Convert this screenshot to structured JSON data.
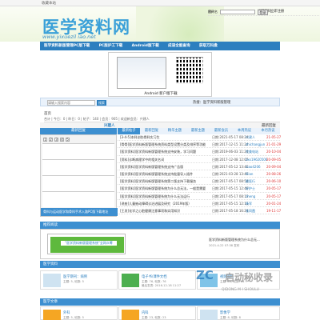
{
  "fav": {
    "label": "收藏本站"
  },
  "header": {
    "logo_cn": "医学资料网",
    "logo_url": "www.yixuezil iao.net"
  },
  "login": {
    "user_label": "用户名",
    "pass_label": "密码",
    "login_btn": "登录",
    "register": "注册",
    "forgot": "找回密码",
    "auto": "立即注册"
  },
  "nav": {
    "items": [
      "医学资料新版管理PC版下载",
      "PC版护工下载",
      "Android版下载",
      "成语全能查询",
      "获取万科盘"
    ]
  },
  "banner": {
    "caption": "Android 新户版下载"
  },
  "search": {
    "placeholder": "请输入搜索内容",
    "button": "搜索",
    "hot": "热搜：医学资料新版管理"
  },
  "crumb": "首页",
  "stats": "合计 | 今日：0 | 昨日：0 | 帖子：140 | 会员：905 | 欢迎新会员：兴建人",
  "toptitle": {
    "left": "兴建人",
    "right": "最新回复"
  },
  "left": {
    "head": "最新回复",
    "pages": [
      "1",
      "2",
      "3",
      "4",
      "5"
    ],
    "caption": "骨科与运动医学和骨科手术入路PC版下载地址"
  },
  "tabs": [
    "最新帖子",
    "最新回复",
    "精华主题",
    "最新主题",
    "最新会员",
    "本周热议",
    "本月热议"
  ],
  "rows": [
    {
      "t": "[3-4-5]本科创伤骨科实习生",
      "d": "日期:2021-05-17 08:24",
      "u": "兴建人",
      "x": "21-05-27"
    },
    {
      "t": "[骨骨]医学资料新版管理系统资料类型设置分类及排序等功能",
      "d": "日期:2017-12-15 11:24",
      "u": "zhichangjun",
      "x": "21-01-29"
    },
    {
      "t": "[医学资料]医学资料新版管理系统支持安装，学习问题",
      "d": "日期:2019-06-03 11:24",
      "u": "完美电站",
      "x": "20-10-04"
    },
    {
      "t": "[资料]诊断病理学中的相关名词",
      "d": "日期:2017-12-08 12:07",
      "u": "bxs19620506",
      "x": "20-09-05"
    },
    {
      "t": "[医学资料]医学资料新版管理系统支持广告版",
      "d": "日期:2017-05-12 13:45",
      "u": "xiao4206",
      "x": "20-09-04"
    },
    {
      "t": "[医学资料]医学资料新版管理系统支持批量导入插件",
      "d": "日期:2021-03-28 13:45",
      "u": "lilian",
      "x": "20-08-26"
    },
    {
      "t": "[医学资料]医学资料新版管理系统第二版支持下载服务",
      "d": "日期:2017-05-17 08:54",
      "u": "跟医行",
      "x": "20-06-10"
    },
    {
      "t": "[医学资料]医学资料新版管理系统为什么总无法，一般是需要",
      "d": "日期:2017-05-15 12:49",
      "u": "好护士",
      "x": "20-05-17"
    },
    {
      "t": "[医学资料]医学资料新版管理系统为什么无法运行",
      "d": "日期:2017-05-17 08:13",
      "u": "zheng",
      "x": "20-05-17"
    },
    {
      "t": "[讲座]儿童抽动障碍诊治进展及研究（2019年版）",
      "d": "日期:2017-05-15 12:11",
      "u": "杨军",
      "x": "20-01-24"
    },
    {
      "t": "[王发]化学之心脏健康注意事项和实用知识",
      "d": "日期:2017-05-18 16:24",
      "u": "张同霞",
      "x": "19-11-17"
    }
  ],
  "recommend": {
    "head": "推荐阅读",
    "img_text": "\"医学资料新版管理系统\"全网众筹",
    "side": "医学资料新版管理系统为什么总无...",
    "side_date": "2021-4-22 07:38 发布"
  },
  "section1": {
    "head": "医学资料",
    "cards": [
      {
        "name": "医学期刊：病例",
        "c1": "主题: 5, 帖数: 5",
        "c2": ""
      },
      {
        "name": "电子书/课件文档",
        "c1": "主题: 76, 帖数: 76",
        "c2": "最后发表: 2016-12-18 11:27"
      },
      {
        "name": "视频资料",
        "c1": "主题: 34, 帖数: 34",
        "c2": ""
      }
    ]
  },
  "section2": {
    "head": "医学文章",
    "cards": [
      {
        "name": "外科",
        "c1": "主题: 5, 帖数: 5"
      },
      {
        "name": "内科",
        "c1": "主题: 23, 帖数: 23"
      },
      {
        "name": "影像学",
        "c1": "主题: 8, 帖数: 8"
      }
    ]
  },
  "watermark": {
    "a": "ZC",
    "b": "启动秘收录",
    "c": "QIDONG M I SHOULU"
  },
  "colors": {
    "accent": "#3d8fd0",
    "nav": "#2c7fbf",
    "logo": "#3aa0d8"
  }
}
